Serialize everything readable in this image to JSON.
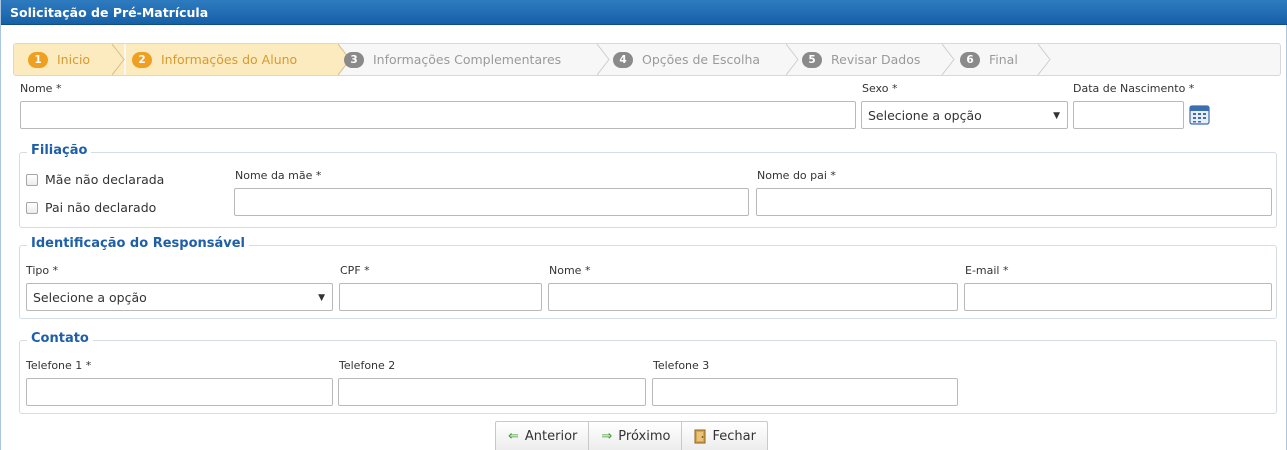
{
  "window": {
    "title": "Solicitação de Pré-Matrícula"
  },
  "steps": [
    {
      "num": "1",
      "label": "Inicio"
    },
    {
      "num": "2",
      "label": "Informações do Aluno"
    },
    {
      "num": "3",
      "label": "Informações Complementares"
    },
    {
      "num": "4",
      "label": "Opções de Escolha"
    },
    {
      "num": "5",
      "label": "Revisar Dados"
    },
    {
      "num": "6",
      "label": "Final"
    }
  ],
  "aluno": {
    "nome_label": "Nome *",
    "nome_value": "",
    "sexo_label": "Sexo *",
    "sexo_value": "Selecione a opção",
    "nascimento_label": "Data de Nascimento *",
    "nascimento_value": ""
  },
  "filiacao": {
    "legend": "Filiação",
    "mae_nao_declarada": "Mãe não declarada",
    "pai_nao_declarado": "Pai não declarado",
    "nome_mae_label": "Nome da mãe *",
    "nome_pai_label": "Nome do pai *"
  },
  "responsavel": {
    "legend": "Identificação do Responsável",
    "tipo_label": "Tipo *",
    "tipo_value": "Selecione a opção",
    "cpf_label": "CPF *",
    "nome_label": "Nome *",
    "email_label": "E-mail *"
  },
  "contato": {
    "legend": "Contato",
    "tel1_label": "Telefone 1 *",
    "tel2_label": "Telefone 2",
    "tel3_label": "Telefone 3"
  },
  "buttons": {
    "anterior": "Anterior",
    "proximo": "Próximo",
    "fechar": "Fechar"
  },
  "icons": {
    "anterior": "arrow-left-icon",
    "proximo": "arrow-right-icon",
    "fechar": "door-icon",
    "calendar": "calendar-icon"
  },
  "colors": {
    "titlebar": "#1f6cb5",
    "active_step_bg": "#fcebbf",
    "active_step_badge": "#f0a020",
    "inactive_badge": "#8a8a8a",
    "legend": "#1e5fa8"
  }
}
